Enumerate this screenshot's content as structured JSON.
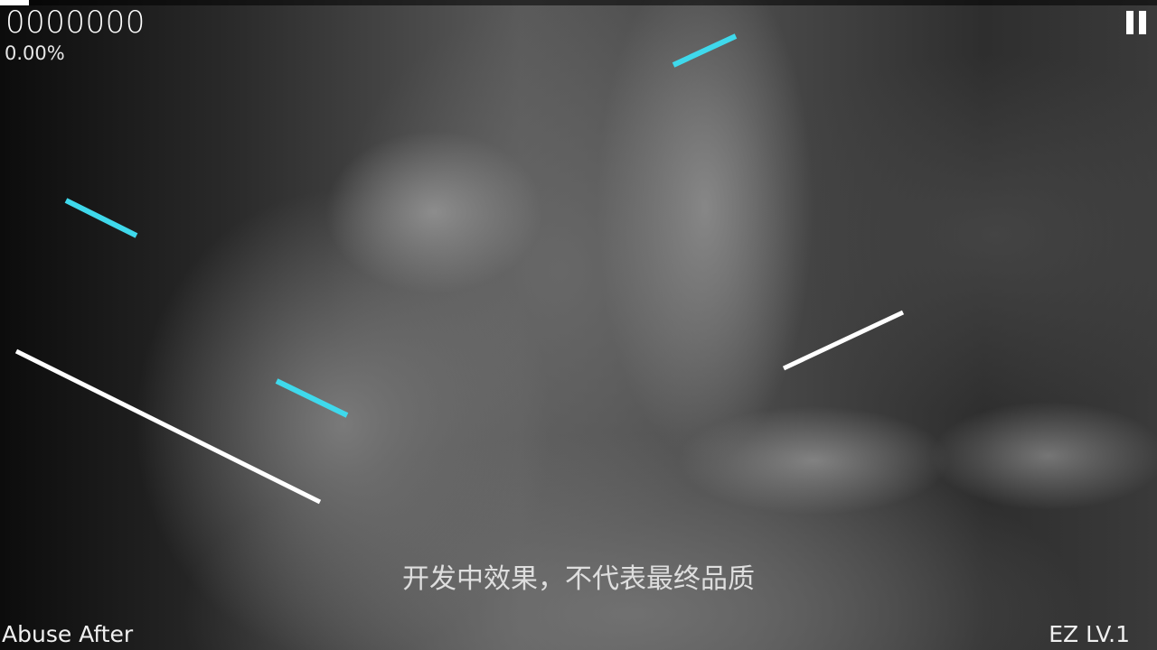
{
  "hud": {
    "score": "0000000",
    "accuracy": "0.00%",
    "song_progress": 0.025
  },
  "watermark": "开发中效果，不代表最终品质",
  "song": {
    "title": "Abuse After",
    "difficulty": "EZ LV.1"
  },
  "colors": {
    "tap_note": "#3fd9ec",
    "judge_line": "#ffffff"
  },
  "icons": {
    "pause": "pause-icon"
  }
}
